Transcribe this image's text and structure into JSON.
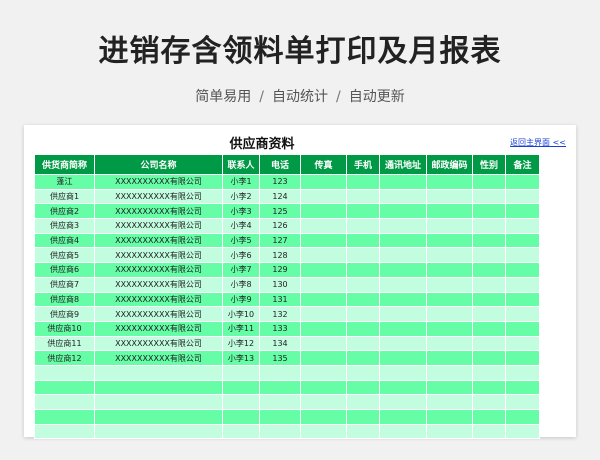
{
  "header": {
    "title": "进销存含领料单打印及月报表",
    "tags": [
      "简单易用",
      "自动统计",
      "自动更新"
    ],
    "separator": "/"
  },
  "sheet": {
    "title": "供应商资料",
    "back_link": "返回主界面 <<",
    "columns": [
      "供货商简称",
      "公司名称",
      "联系人",
      "电话",
      "传真",
      "手机",
      "通讯地址",
      "邮政编码",
      "性别",
      "备注"
    ],
    "rows": [
      [
        "蓬江",
        "XXXXXXXXXX有限公司",
        "小李1",
        "123",
        "",
        "",
        "",
        "",
        "",
        ""
      ],
      [
        "供应商1",
        "XXXXXXXXXX有限公司",
        "小李2",
        "124",
        "",
        "",
        "",
        "",
        "",
        ""
      ],
      [
        "供应商2",
        "XXXXXXXXXX有限公司",
        "小李3",
        "125",
        "",
        "",
        "",
        "",
        "",
        ""
      ],
      [
        "供应商3",
        "XXXXXXXXXX有限公司",
        "小李4",
        "126",
        "",
        "",
        "",
        "",
        "",
        ""
      ],
      [
        "供应商4",
        "XXXXXXXXXX有限公司",
        "小李5",
        "127",
        "",
        "",
        "",
        "",
        "",
        ""
      ],
      [
        "供应商5",
        "XXXXXXXXXX有限公司",
        "小李6",
        "128",
        "",
        "",
        "",
        "",
        "",
        ""
      ],
      [
        "供应商6",
        "XXXXXXXXXX有限公司",
        "小李7",
        "129",
        "",
        "",
        "",
        "",
        "",
        ""
      ],
      [
        "供应商7",
        "XXXXXXXXXX有限公司",
        "小李8",
        "130",
        "",
        "",
        "",
        "",
        "",
        ""
      ],
      [
        "供应商8",
        "XXXXXXXXXX有限公司",
        "小李9",
        "131",
        "",
        "",
        "",
        "",
        "",
        ""
      ],
      [
        "供应商9",
        "XXXXXXXXXX有限公司",
        "小李10",
        "132",
        "",
        "",
        "",
        "",
        "",
        ""
      ],
      [
        "供应商10",
        "XXXXXXXXXX有限公司",
        "小李11",
        "133",
        "",
        "",
        "",
        "",
        "",
        ""
      ],
      [
        "供应商11",
        "XXXXXXXXXX有限公司",
        "小李12",
        "134",
        "",
        "",
        "",
        "",
        "",
        ""
      ],
      [
        "供应商12",
        "XXXXXXXXXX有限公司",
        "小李13",
        "135",
        "",
        "",
        "",
        "",
        "",
        ""
      ],
      [
        "",
        "",
        "",
        "",
        "",
        "",
        "",
        "",
        "",
        ""
      ],
      [
        "",
        "",
        "",
        "",
        "",
        "",
        "",
        "",
        "",
        ""
      ],
      [
        "",
        "",
        "",
        "",
        "",
        "",
        "",
        "",
        "",
        ""
      ],
      [
        "",
        "",
        "",
        "",
        "",
        "",
        "",
        "",
        "",
        ""
      ],
      [
        "",
        "",
        "",
        "",
        "",
        "",
        "",
        "",
        "",
        ""
      ]
    ]
  },
  "colors": {
    "header_bg": "#009a46",
    "row_dark": "#66fda7",
    "row_light": "#c2fde0",
    "link": "#1a3fd6"
  }
}
